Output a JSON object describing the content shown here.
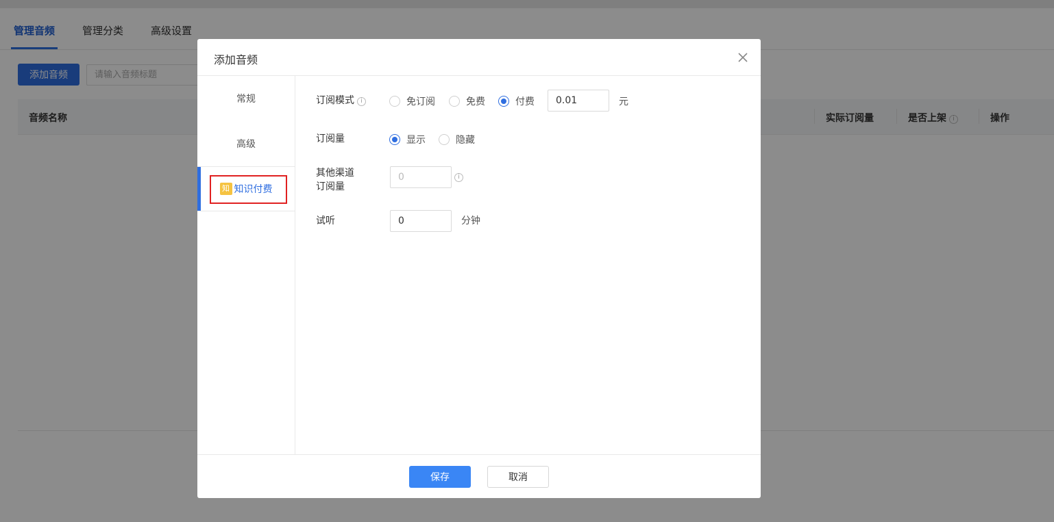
{
  "tabs": [
    {
      "label": "管理音频",
      "active": true
    },
    {
      "label": "管理分类",
      "active": false
    },
    {
      "label": "高级设置",
      "active": false
    }
  ],
  "toolbar": {
    "add_label": "添加音频",
    "search_placeholder": "请输入音频标题"
  },
  "table": {
    "headers": [
      "音频名称",
      "实际订阅量",
      "是否上架",
      "操作"
    ]
  },
  "modal": {
    "title": "添加音频",
    "side": [
      {
        "label": "常规",
        "active": false
      },
      {
        "label": "高级",
        "active": false
      },
      {
        "label": "知识付费",
        "active": true,
        "icon": "knowledge-pay-icon",
        "icon_glyph": "知"
      }
    ],
    "form": {
      "subscription_mode": {
        "label": "订阅模式",
        "options": [
          "免订阅",
          "免费",
          "付费"
        ],
        "selected": "付费",
        "price_value": "0.01",
        "price_unit": "元"
      },
      "subscription_count": {
        "label": "订阅量",
        "options": [
          "显示",
          "隐藏"
        ],
        "selected": "显示"
      },
      "other_channel": {
        "label_line1": "其他渠道",
        "label_line2": "订阅量",
        "value": "0"
      },
      "trial": {
        "label": "试听",
        "value": "0",
        "unit": "分钟"
      }
    },
    "footer": {
      "save_label": "保存",
      "cancel_label": "取消"
    }
  },
  "colors": {
    "accent": "#2f6ee0",
    "save_button": "#3a86f5",
    "highlight_box": "#e02020",
    "icon_yellow": "#f5c342"
  }
}
